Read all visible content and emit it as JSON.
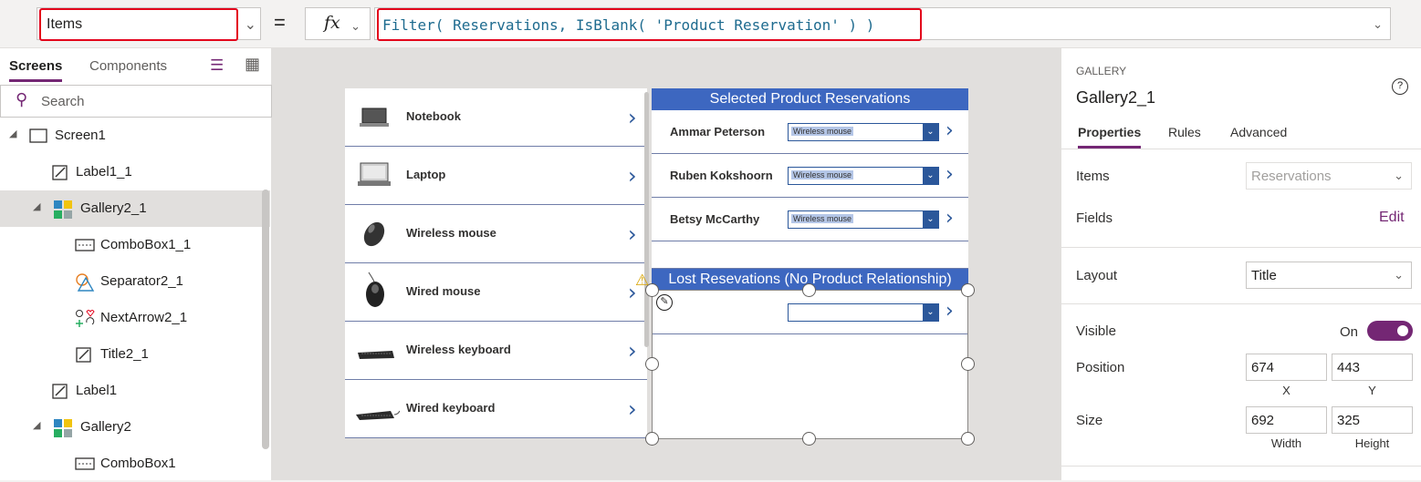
{
  "formula_bar": {
    "property": "Items",
    "equals": "=",
    "fx": "fx",
    "formula": "Filter( Reservations, IsBlank( 'Product Reservation' ) )"
  },
  "tree": {
    "tabs": [
      "Screens",
      "Components"
    ],
    "search_placeholder": "Search",
    "items": [
      {
        "label": "Screen1",
        "icon": "screen-icon"
      },
      {
        "label": "Label1_1",
        "icon": "label-icon"
      },
      {
        "label": "Gallery2_1",
        "icon": "gallery-icon"
      },
      {
        "label": "ComboBox1_1",
        "icon": "combobox-icon"
      },
      {
        "label": "Separator2_1",
        "icon": "shapes-icon"
      },
      {
        "label": "NextArrow2_1",
        "icon": "icons-icon"
      },
      {
        "label": "Title2_1",
        "icon": "label-icon"
      },
      {
        "label": "Label1",
        "icon": "label-icon"
      },
      {
        "label": "Gallery2",
        "icon": "gallery-icon"
      },
      {
        "label": "ComboBox1",
        "icon": "combobox-icon"
      }
    ]
  },
  "canvas": {
    "products": [
      {
        "name": "Notebook",
        "thumb": "notebook-image"
      },
      {
        "name": "Laptop",
        "thumb": "laptop-image"
      },
      {
        "name": "Wireless mouse",
        "thumb": "wireless-mouse-image"
      },
      {
        "name": "Wired mouse",
        "thumb": "wired-mouse-image"
      },
      {
        "name": "Wireless keyboard",
        "thumb": "wireless-keyboard-image"
      },
      {
        "name": "Wired keyboard",
        "thumb": "wired-keyboard-image"
      }
    ],
    "selected_header": "Selected Product Reservations",
    "reservations": [
      {
        "name": "Ammar Peterson",
        "value": "Wireless mouse"
      },
      {
        "name": "Ruben Kokshoorn",
        "value": "Wireless mouse"
      },
      {
        "name": "Betsy McCarthy",
        "value": "Wireless mouse"
      }
    ],
    "lost_header": "Lost Resevations (No Product Relationship)",
    "lost_rows": [
      {
        "name": "",
        "value": ""
      }
    ]
  },
  "properties": {
    "type": "GALLERY",
    "name": "Gallery2_1",
    "tabs": [
      "Properties",
      "Rules",
      "Advanced"
    ],
    "items_label": "Items",
    "items_value": "Reservations",
    "fields_label": "Fields",
    "fields_edit": "Edit",
    "layout_label": "Layout",
    "layout_value": "Title",
    "visible_label": "Visible",
    "visible_state": "On",
    "position_label": "Position",
    "x": "674",
    "y": "443",
    "x_label": "X",
    "y_label": "Y",
    "size_label": "Size",
    "width": "692",
    "height": "325",
    "width_label": "Width",
    "height_label": "Height"
  },
  "colors": {
    "accent": "#742774",
    "header_blue": "#3d67c0",
    "highlight_red": "#e3001b"
  }
}
